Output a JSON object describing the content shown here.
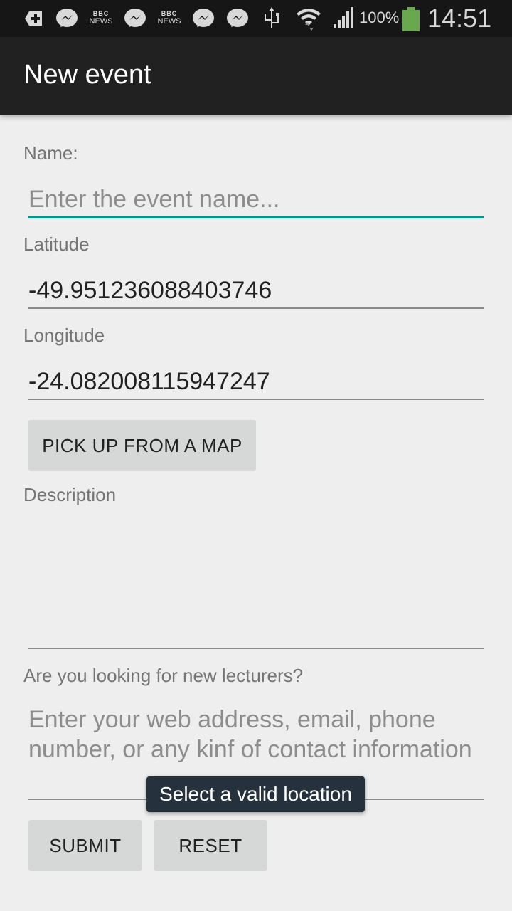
{
  "status_bar": {
    "icons": [
      "plus-notification-icon",
      "messenger-icon",
      "bbc-news-icon",
      "messenger-icon",
      "bbc-news-icon",
      "messenger-icon",
      "messenger-icon",
      "usb-icon",
      "wifi-icon",
      "signal-icon"
    ],
    "bbc_top": "BBC",
    "bbc_bottom": "NEWS",
    "battery_percent": "100%",
    "battery_color": "#6aa84f",
    "time": "14:51"
  },
  "action_bar": {
    "title": "New event"
  },
  "form": {
    "name_label": "Name:",
    "name_placeholder": "Enter the event name...",
    "latitude_label": "Latitude",
    "latitude_value": "-49.951236088403746",
    "longitude_label": "Longitude",
    "longitude_value": "-24.082008115947247",
    "pick_map_button": "PICK UP FROM A MAP",
    "description_label": "Description",
    "description_value": "",
    "lecturers_label": "Are you looking for new lecturers?",
    "contact_placeholder": "Enter your web address, email, phone number, or any kinf of contact information",
    "submit_button": "SUBMIT",
    "reset_button": "RESET"
  },
  "toast": {
    "message": "Select a valid location"
  },
  "colors": {
    "accent": "#009688",
    "action_bar": "#212121",
    "background": "#eeeeee"
  }
}
